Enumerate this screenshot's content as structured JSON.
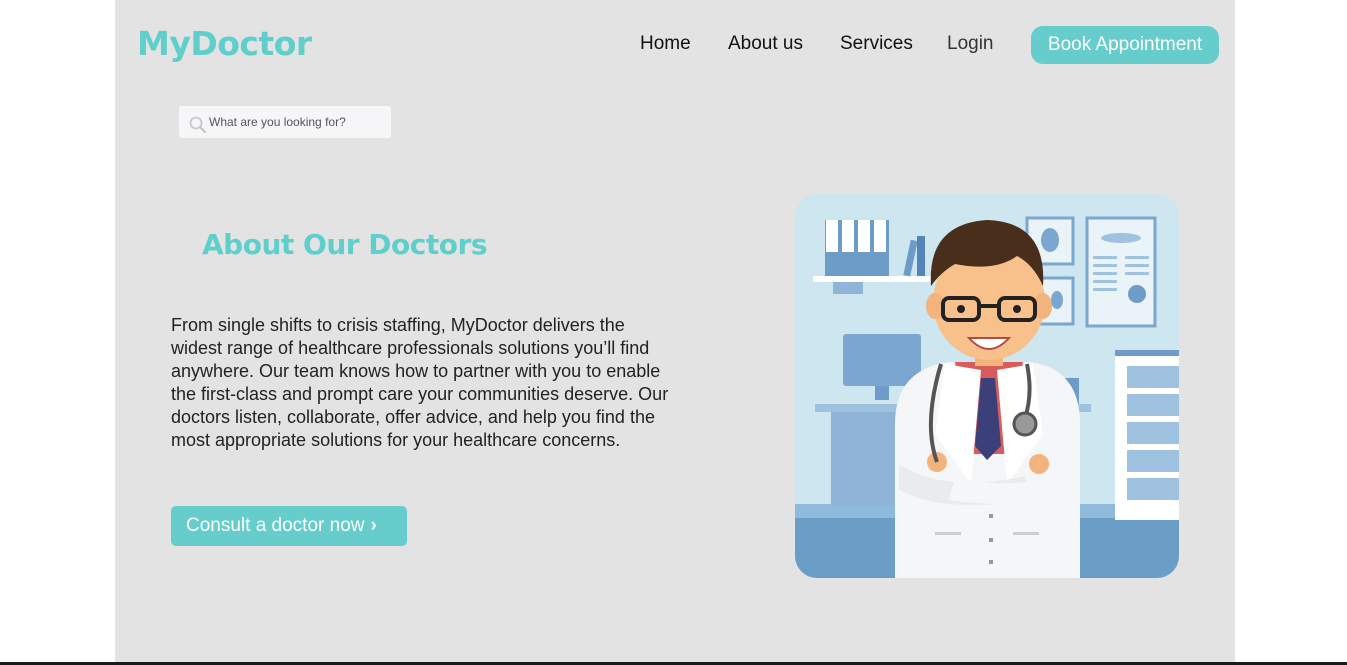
{
  "brand": {
    "logo": "MyDoctor",
    "accent": "#66cccc",
    "logo_color": "#5ecfcb"
  },
  "nav": {
    "home": "Home",
    "about": "About us",
    "services": "Services",
    "login": "Login",
    "book": "Book Appointment"
  },
  "search": {
    "placeholder": "What are you looking for?"
  },
  "about": {
    "heading": "About Our Doctors",
    "text": "From single shifts to crisis staffing, MyDoctor delivers the widest range of healthcare professionals solutions you’ll find anywhere. Our team knows how to partner with you to enable the first-class and prompt care your communities deserve. Our doctors listen, collaborate, offer advice, and help you find the most appropriate solutions for your healthcare concerns.",
    "cta": "Consult a doctor now",
    "cta_icon": "chevron-right-icon"
  },
  "illustration": {
    "subject": "doctor-illustration"
  },
  "colors": {
    "page_bg": "#e3e3e3",
    "text": "#222222"
  }
}
